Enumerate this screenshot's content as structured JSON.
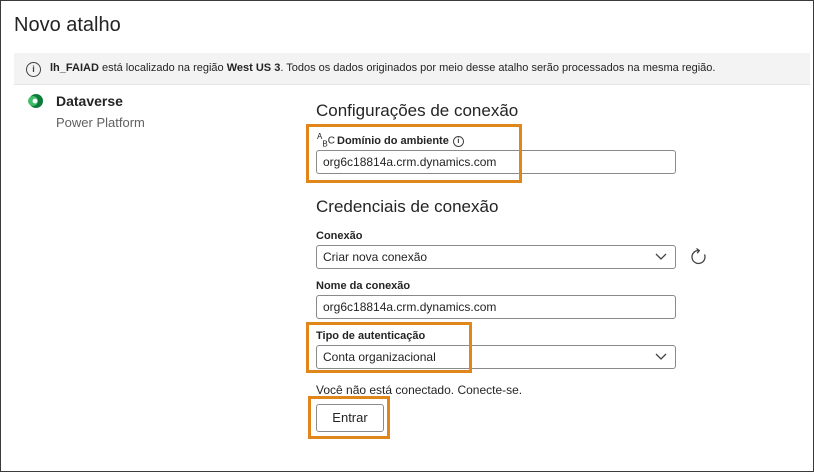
{
  "window": {
    "title": "Novo atalho"
  },
  "info_bar": {
    "lakehouse": "lh_FAIAD",
    "text_1": " está localizado na região ",
    "region": "West US 3",
    "text_2": ". Todos os dados originados por meio desse atalho serão processados na mesma região."
  },
  "source": {
    "name": "Dataverse",
    "subtitle": "Power Platform"
  },
  "connection_settings": {
    "heading": "Configurações de conexão",
    "env_domain_label": "Domínio do ambiente",
    "env_domain_value": "org6c18814a.crm.dynamics.com"
  },
  "credentials": {
    "heading": "Credenciais de conexão",
    "connection_label": "Conexão",
    "connection_value": "Criar nova conexão",
    "connection_name_label": "Nome da conexão",
    "connection_name_value": "org6c18814a.crm.dynamics.com",
    "auth_type_label": "Tipo de autenticação",
    "auth_type_value": "Conta organizacional",
    "status_text": "Você não está conectado. Conecte-se.",
    "sign_in_label": "Entrar"
  },
  "colors": {
    "highlight": "#e0861a",
    "info_bar_bg": "#f3f3f3"
  },
  "icons": [
    "info-icon",
    "dataverse-icon",
    "abc-icon",
    "chevron-down-icon",
    "refresh-icon"
  ]
}
